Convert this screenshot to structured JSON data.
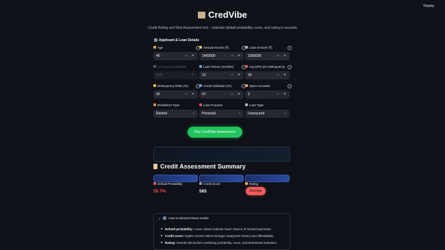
{
  "header": {
    "deploy_label": "Deploy"
  },
  "app": {
    "title": "CredVibe",
    "subtitle": "Credit Rating and Risk Assessment tool – estimate default probability, score, and rating in seconds"
  },
  "section": {
    "heading": "Applicant & Loan Details"
  },
  "fields": {
    "age": {
      "label": "Age",
      "value": "45"
    },
    "annual_income": {
      "label": "Annual Income (₹)",
      "value": "1400000"
    },
    "loan_amount": {
      "label": "Loan Amount (₹)",
      "value": "1000000"
    },
    "lti": {
      "label": "LTI (Loan to Income)",
      "value": "0.71"
    },
    "loan_tenure": {
      "label": "Loan Tenure (months)",
      "value": "12"
    },
    "avg_dpd": {
      "label": "Avg DPD per Delinquency",
      "value": "29"
    },
    "delinquency_ratio": {
      "label": "Delinquency Ratio (%)",
      "value": "26"
    },
    "credit_utilization": {
      "label": "Credit Utilization (%)",
      "value": "47"
    },
    "open_accounts": {
      "label": "Open Accounts",
      "value": "2"
    },
    "residence_type": {
      "label": "Residence Type",
      "value": "Rented"
    },
    "loan_purpose": {
      "label": "Loan Purpose",
      "value": "Personal"
    },
    "loan_type": {
      "label": "Loan Type",
      "value": "Unsecured"
    }
  },
  "stepper": {
    "minus": "−",
    "plus": "+"
  },
  "run_button": {
    "label": "Run CredVibe Assessment"
  },
  "summary": {
    "title": "Credit Assessment Summary",
    "default_probability": {
      "label": "Default Probability",
      "value": "55.7%"
    },
    "credit_score": {
      "label": "Credit Score",
      "value": "565"
    },
    "rating": {
      "label": "Rating",
      "value": "Average"
    }
  },
  "expander": {
    "title": "How to interpret these results",
    "bullets": [
      {
        "term": "Default probability:",
        "text": " Lower values indicate lower chance of missed payments."
      },
      {
        "term": "Credit score:",
        "text": " Higher scores reflect stronger repayment history and affordability."
      },
      {
        "term": "Rating:",
        "text": " Overall risk bucket combining probability, score, and behavioral indicators."
      }
    ]
  },
  "colors": {
    "background": "#0e1117",
    "accent_green": "#21c35c",
    "probability_red": "#ff4b4b",
    "rating_pill": "#f25c5c",
    "metric_bar": "#2a4aa0"
  }
}
